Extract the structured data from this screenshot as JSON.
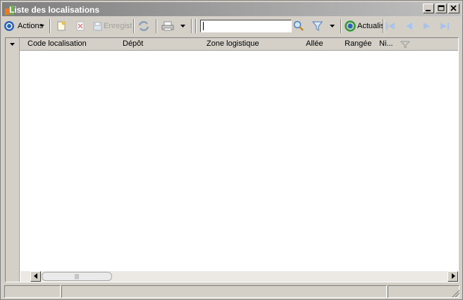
{
  "window": {
    "title": "Liste des localisations",
    "caption_buttons": [
      "minimize",
      "maximize",
      "close"
    ]
  },
  "toolbar": {
    "actions_label": "Actions",
    "save_label": "Enregist",
    "refresh_label": "Actualis",
    "search_value": "",
    "icons": [
      "actions-icon",
      "new-icon",
      "delete-icon",
      "save-icon",
      "sync-icon",
      "print-icon",
      "search-icon",
      "filter-icon",
      "refresh-icon",
      "first-icon",
      "prev-icon",
      "next-icon",
      "last-icon"
    ]
  },
  "grid": {
    "columns": [
      "Code localisation",
      "Dépôt",
      "Zone logistique",
      "Allée",
      "Rangée",
      "Ni..."
    ],
    "rows": []
  },
  "colors": {
    "chrome": "#d4d0c8",
    "title_bar": "#7f7f7f",
    "accent_blue": "#1f5fb0"
  }
}
